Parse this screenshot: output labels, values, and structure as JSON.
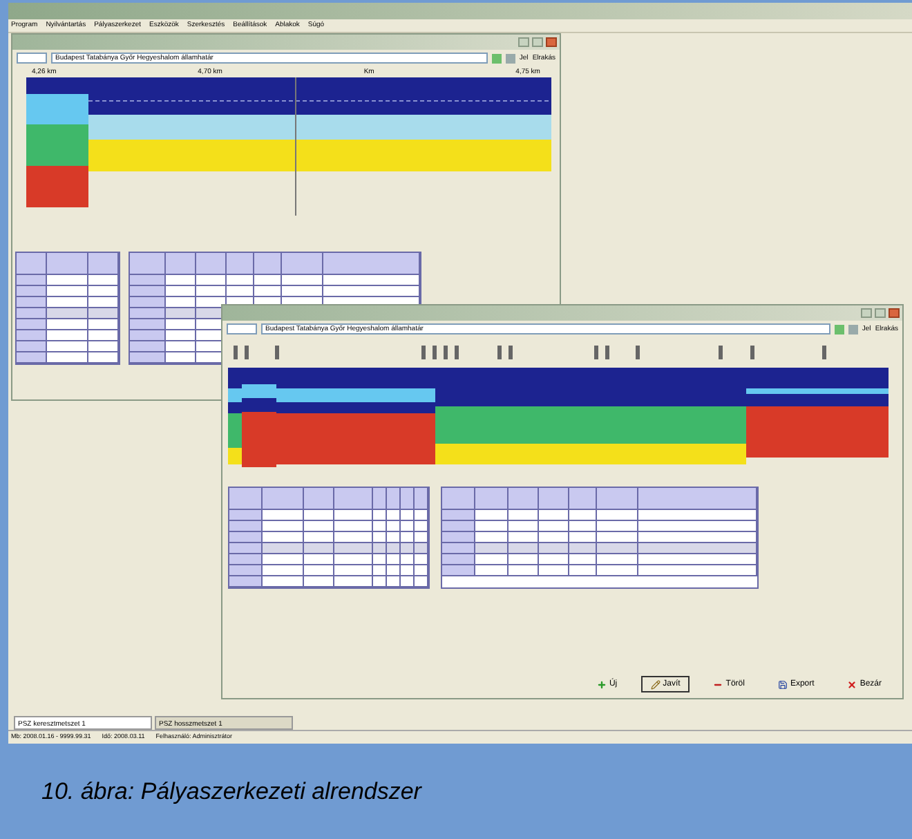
{
  "menu": [
    {
      "label": "Program"
    },
    {
      "label": "Nyilvántartás"
    },
    {
      "label": "Pályaszerkezet"
    },
    {
      "label": "Eszközök"
    },
    {
      "label": "Szerkesztés"
    },
    {
      "label": "Beállítások"
    },
    {
      "label": "Ablakok"
    },
    {
      "label": "Súgó"
    }
  ],
  "cross_section_window": {
    "route": "Budapest Tatabánya Győr Hegyeshalom államhatár",
    "axis": [
      "4,26 km",
      "4,70 km",
      "Km",
      "4,75 km"
    ],
    "toolbar": [
      "Jel",
      "Elrakás"
    ]
  },
  "long_section_window": {
    "route": "Budapest Tatabánya Győr Hegyeshalom államhatár",
    "toolbar": [
      "Jel",
      "Elrakás"
    ],
    "buttons": [
      {
        "label": "Új",
        "kind": "add"
      },
      {
        "label": "Javít",
        "kind": "edit"
      },
      {
        "label": "Töröl",
        "kind": "delete"
      },
      {
        "label": "Export",
        "kind": "export"
      },
      {
        "label": "Bezár",
        "kind": "close"
      }
    ]
  },
  "tabs": [
    {
      "label": "PSZ keresztmetszet 1",
      "selected": true
    },
    {
      "label": "PSZ hosszmetszet 1",
      "selected": false
    }
  ],
  "status_bar": [
    "Mb: 2008.01.16 - 9999.99.31",
    "Idő: 2008.03.11",
    "Felhasználó: Adminisztrátor"
  ],
  "caption": "10. ábra: Pályaszerkezeti alrendszer"
}
